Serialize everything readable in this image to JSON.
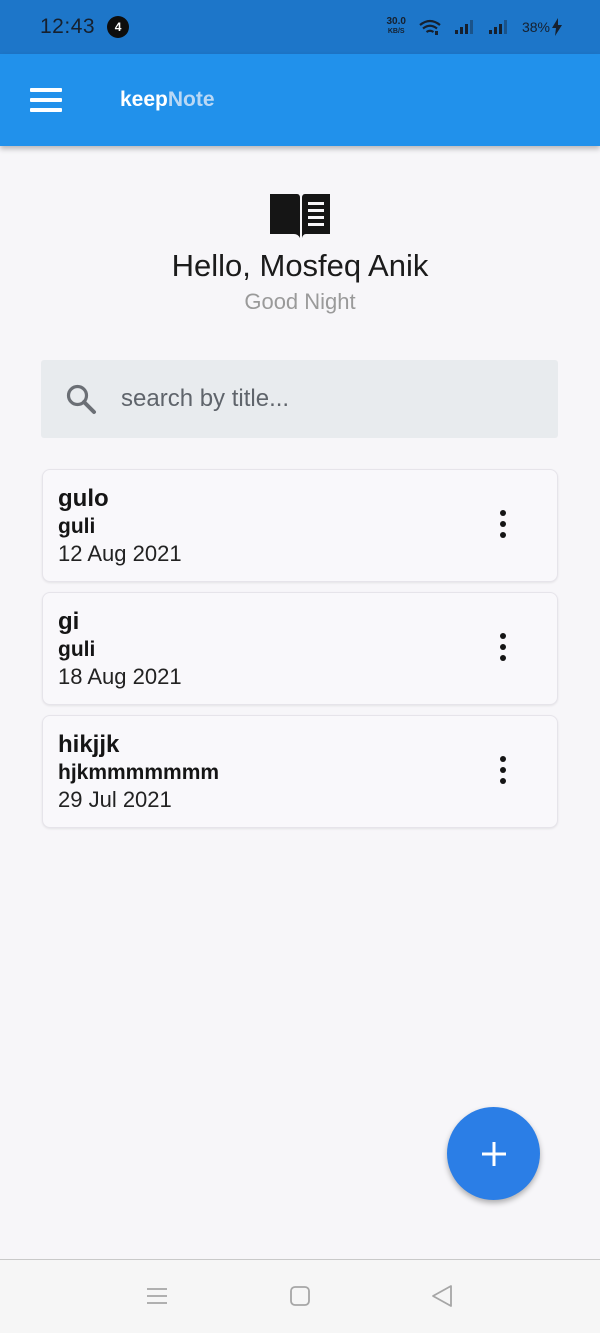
{
  "status_bar": {
    "time": "12:43",
    "notification_count": "4",
    "net_speed": "30.0",
    "net_unit": "KB/S",
    "battery": "38%"
  },
  "app_bar": {
    "title_part1": "keep",
    "title_part2": "Note"
  },
  "header": {
    "greeting": "Hello, Mosfeq Anik",
    "subtitle": "Good Night"
  },
  "search": {
    "placeholder": "search by title..."
  },
  "notes": [
    {
      "title": "gulo",
      "body": "guli",
      "date": "12 Aug 2021"
    },
    {
      "title": "gi",
      "body": "guli",
      "date": "18 Aug 2021"
    },
    {
      "title": "hikjjk",
      "body": "hjkmmmmmmm",
      "date": "29 Jul 2021"
    }
  ],
  "colors": {
    "status_bar": "#1d76c9",
    "app_bar": "#2191eb",
    "fab": "#2b7ee6",
    "background": "#f7f6f9"
  },
  "icons": {
    "menu": "hamburger-icon",
    "book": "book-icon",
    "search": "search-icon",
    "note_menu": "more-vert-icon",
    "fab": "plus-icon"
  }
}
